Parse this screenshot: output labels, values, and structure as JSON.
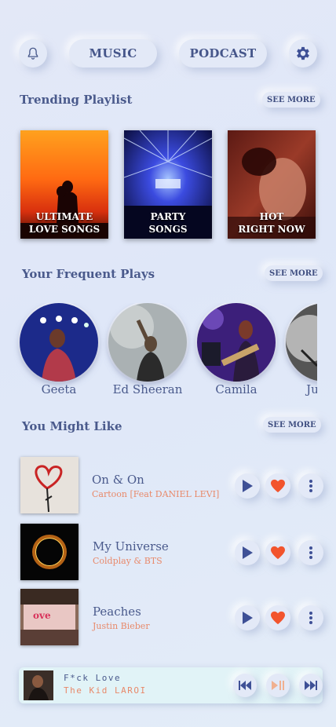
{
  "header": {
    "tabs": [
      {
        "label": "MUSIC"
      },
      {
        "label": "PODCAST"
      }
    ],
    "icons": {
      "left": "bell-icon",
      "right": "gear-icon"
    }
  },
  "trending": {
    "title": "Trending Playlist",
    "see_more": "SEE MORE",
    "cards": [
      {
        "line1": "ULTIMATE",
        "line2": "LOVE SONGS"
      },
      {
        "line1": "PARTY",
        "line2": "SONGS"
      },
      {
        "line1": "HOT",
        "line2": "RIGHT NOW"
      }
    ]
  },
  "frequent": {
    "title": "Your Frequent Plays",
    "see_more": "SEE MORE",
    "artists": [
      {
        "name": "Geeta"
      },
      {
        "name": "Ed Sheeran"
      },
      {
        "name": "Camila"
      },
      {
        "name": "Justin"
      }
    ]
  },
  "might_like": {
    "title": "You Might Like",
    "see_more": "SEE MORE",
    "songs": [
      {
        "title": "On & On",
        "artist": "Cartoon [Feat DANIEL LEVI]"
      },
      {
        "title": "My Universe",
        "artist": "Coldplay & BTS"
      },
      {
        "title": "Peaches",
        "artist": "Justin Bieber"
      }
    ]
  },
  "now_playing": {
    "title": "F*ck Love",
    "artist": "The Kid LAROI"
  },
  "colors": {
    "accent": "#e8896a",
    "heart": "#f2542d",
    "primary": "#3e5096"
  }
}
